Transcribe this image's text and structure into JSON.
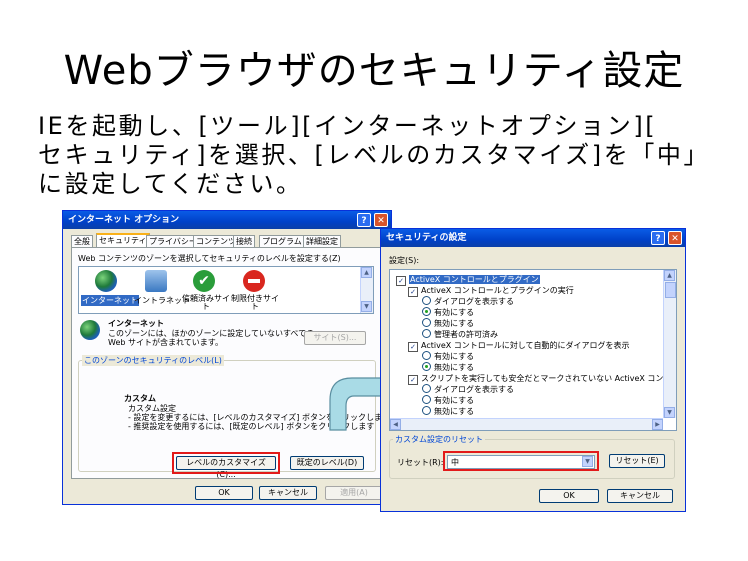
{
  "slide": {
    "title": "Webブラウザのセキュリティ設定",
    "lines": [
      "IEを起動し、[ツール][インターネットオプション][",
      "セキュリティ]を選択、[レベルのカスタマイズ]を「中」",
      "に設定してください。"
    ]
  },
  "internet_options": {
    "title": "インターネット オプション",
    "help": "?",
    "close": "✕",
    "tabs": [
      "全般",
      "セキュリティ",
      "プライバシー",
      "コンテンツ",
      "接続",
      "プログラム",
      "詳細設定"
    ],
    "zone_prompt": "Web コンテンツのゾーンを選択してセキュリティのレベルを設定する(Z)",
    "zones": [
      {
        "line1": "インターネット",
        "line2": "",
        "icon": "globe-icon"
      },
      {
        "line1": "イントラネット",
        "line2": "",
        "icon": "intranet-icon"
      },
      {
        "line1": "信頼済みサイ",
        "line2": "ト",
        "icon": "check-icon"
      },
      {
        "line1": "制限付きサイ",
        "line2": "ト",
        "icon": "restricted-icon"
      }
    ],
    "zone_name": "インターネット",
    "zone_desc1": "このゾーンには、ほかのゾーンに設定していないすべての",
    "zone_desc2": "Web サイトが含まれています。",
    "sites_button": "サイト(S)...",
    "level_group": "このゾーンのセキュリティのレベル(L)",
    "level_name": "カスタム",
    "level_line1": "カスタム設定",
    "level_line2": "- 設定を変更するには、[レベルのカスタマイズ] ボタンをクリックします",
    "level_line3": "- 推奨設定を使用するには、[既定のレベル] ボタンをクリックします",
    "custom_button": "レベルのカスタマイズ(C)...",
    "default_button": "既定のレベル(D)",
    "ok": "OK",
    "cancel": "キャンセル",
    "apply": "適用(A)"
  },
  "security_settings": {
    "title": "セキュリティの設定",
    "help": "?",
    "close": "✕",
    "settings_label": "設定(S):",
    "tree": [
      {
        "kind": "header",
        "text": "ActiveX コントロールとプラグイン"
      },
      {
        "kind": "check",
        "text": "ActiveX コントロールとプラグインの実行"
      },
      {
        "kind": "radio",
        "on": false,
        "text": "ダイアログを表示する"
      },
      {
        "kind": "radio",
        "on": true,
        "text": "有効にする"
      },
      {
        "kind": "radio",
        "on": false,
        "text": "無効にする"
      },
      {
        "kind": "radio",
        "on": false,
        "text": "管理者の許可済み"
      },
      {
        "kind": "check",
        "text": "ActiveX コントロールに対して自動的にダイアログを表示"
      },
      {
        "kind": "radio",
        "on": false,
        "text": "有効にする"
      },
      {
        "kind": "radio",
        "on": true,
        "text": "無効にする"
      },
      {
        "kind": "check",
        "text": "スクリプトを実行しても安全だとマークされていない ActiveX コントロー"
      },
      {
        "kind": "radio",
        "on": false,
        "text": "ダイアログを表示する"
      },
      {
        "kind": "radio",
        "on": false,
        "text": "有効にする"
      },
      {
        "kind": "radio",
        "on": false,
        "text": "無効にする"
      }
    ],
    "reset_group": "カスタム設定のリセット",
    "reset_label": "リセット(R):",
    "reset_value": "中",
    "reset_button": "リセット(E)",
    "ok": "OK",
    "cancel": "キャンセル"
  },
  "colors": {
    "highlight": "#e21a1a",
    "arrow": "#a9dbe6",
    "arrow_stroke": "#5a8ea0",
    "titlebar": "#0a5ce6"
  }
}
